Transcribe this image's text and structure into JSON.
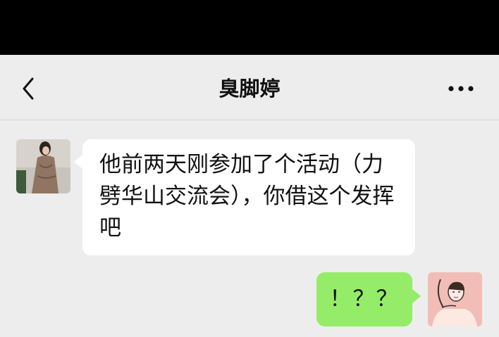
{
  "header": {
    "title": "臭脚婷",
    "back_icon": "chevron-left-icon",
    "more_icon": "ellipsis-icon"
  },
  "messages": [
    {
      "sender": "other",
      "avatar_icon": "avatar-photo",
      "text": "他前两天刚参加了个活动（力劈华山交流会），你借这个发挥吧"
    },
    {
      "sender": "me",
      "avatar_icon": "avatar-illustration",
      "text": "！？？"
    }
  ],
  "colors": {
    "status_bar": "#000000",
    "background": "#ededed",
    "incoming_bubble": "#ffffff",
    "outgoing_bubble": "#95ec69"
  }
}
